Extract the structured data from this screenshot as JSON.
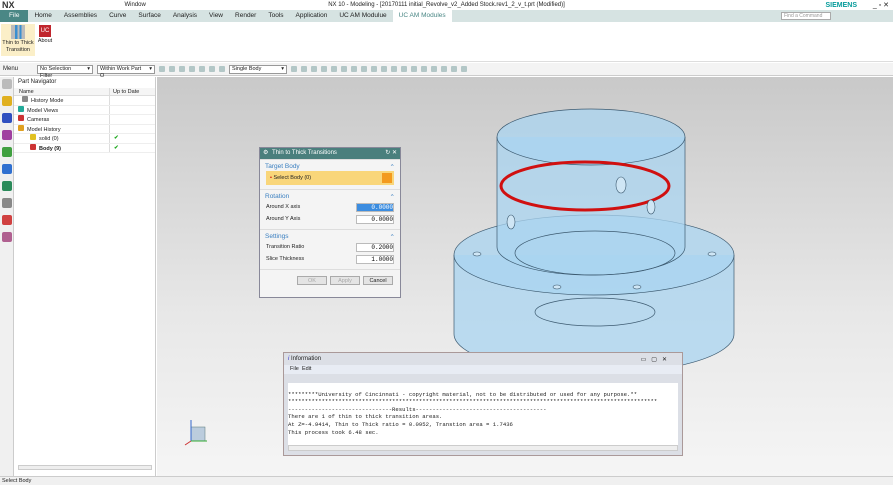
{
  "titlebar": {
    "app": "NX",
    "window_menu": "Window",
    "title": "NX 10 - Modeling - [20170111 initial_Revolve_v2_Added Stock.rev1_2_v_t.prt (Modified)]",
    "brand": "SIEMENS"
  },
  "tabs": [
    "File",
    "Home",
    "Assemblies",
    "Curve",
    "Surface",
    "Analysis",
    "View",
    "Render",
    "Tools",
    "Application",
    "UC AM Modulue",
    "UC AM Modules"
  ],
  "active_tab": "UC AM Modules",
  "search_placeholder": "Find a Command",
  "ribbon": {
    "thin_to_thick": "Thin to Thick Transition",
    "about": "About"
  },
  "toolbar": {
    "menu": "Menu",
    "filter": "No Selection Filter",
    "scope": "Within Work Part O",
    "body": "Single Body"
  },
  "navigator": {
    "title": "Part Navigator",
    "col_name": "Name",
    "col_uptodate": "Up to Date",
    "items": [
      {
        "label": "History Mode",
        "check": ""
      },
      {
        "label": "Model Views",
        "check": ""
      },
      {
        "label": "Cameras",
        "check": ""
      },
      {
        "label": "Model History",
        "check": ""
      },
      {
        "label": "solid (0)",
        "check": "✔"
      },
      {
        "label": "Body (9)",
        "check": "✔"
      }
    ]
  },
  "dialog": {
    "title": "Thin to Thick Transitions",
    "target_body": "Target Body",
    "select_body": "Select Body (0)",
    "rotation": "Rotation",
    "around_x": "Around X axis",
    "around_x_value": "0.0000",
    "around_y": "Around Y Axis",
    "around_y_value": "0.0000",
    "settings": "Settings",
    "transition_ratio": "Transition Ratio",
    "transition_ratio_value": "0.2000",
    "slice_thickness": "Slice Thickness",
    "slice_thickness_value": "1.0000",
    "ok": "OK",
    "apply": "Apply",
    "cancel": "Cancel"
  },
  "info": {
    "title": "Information",
    "menu_file": "File",
    "menu_edit": "Edit",
    "text": "\n*********University of Cincinnati - copyright material, not to be distributed or used for any purpose.**\n**************************************************************************************************************\n-------------------------------Results---------------------------------------\nThere are 1 of thin to thick transition areas.\nAt Z=-4.9414, Thin to Thick ratio = 0.0952, Transtion area = 1.7436\nThis process took 6.48 sec."
  },
  "status": "Select Body",
  "colors": {
    "accent": "#4a8785",
    "highlight_ring": "#d01010",
    "part": "#a9d4f0"
  }
}
